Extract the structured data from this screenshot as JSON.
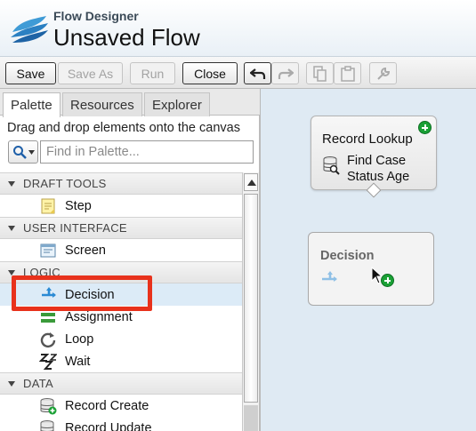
{
  "header": {
    "app_name": "Flow Designer",
    "flow_title": "Unsaved Flow"
  },
  "toolbar": {
    "save": "Save",
    "save_as": "Save As",
    "run": "Run",
    "close": "Close",
    "icons": [
      "undo-icon",
      "redo-icon",
      "copy-icon",
      "paste-icon",
      "wrench-icon"
    ]
  },
  "tabs": [
    {
      "label": "Palette"
    },
    {
      "label": "Resources"
    },
    {
      "label": "Explorer"
    }
  ],
  "palette": {
    "hint": "Drag and drop elements onto the canvas",
    "search_placeholder": "Find in Palette...",
    "sections": [
      {
        "title": "DRAFT TOOLS",
        "items": [
          {
            "label": "Step",
            "icon": "step-icon"
          }
        ]
      },
      {
        "title": "USER INTERFACE",
        "items": [
          {
            "label": "Screen",
            "icon": "screen-icon"
          }
        ]
      },
      {
        "title": "LOGIC",
        "items": [
          {
            "label": "Decision",
            "icon": "decision-icon"
          },
          {
            "label": "Assignment",
            "icon": "assignment-icon"
          },
          {
            "label": "Loop",
            "icon": "loop-icon"
          },
          {
            "label": "Wait",
            "icon": "wait-icon"
          }
        ]
      },
      {
        "title": "DATA",
        "items": [
          {
            "label": "Record Create",
            "icon": "record-create-icon"
          },
          {
            "label": "Record Update",
            "icon": "record-update-icon"
          }
        ]
      }
    ]
  },
  "canvas": {
    "record_lookup": {
      "type": "Record Lookup",
      "name": "Find Case Status Age"
    },
    "decision": {
      "label": "Decision"
    }
  },
  "colors": {
    "canvas": "#dfeaf3",
    "highlight": "#e8321c",
    "selected_row": "#dcebf7",
    "add_badge": "#1aa035"
  }
}
